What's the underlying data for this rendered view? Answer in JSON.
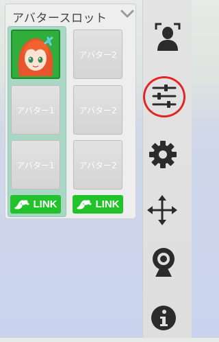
{
  "panel": {
    "title": "アバタースロット",
    "chevron_icon": "chevron-down-icon"
  },
  "slots": {
    "left": [
      {
        "label": "",
        "selected": true,
        "content": "avatar-thumbnail"
      },
      {
        "label": "アバター1"
      },
      {
        "label": "アバター1"
      }
    ],
    "right": [
      {
        "label": "アバター2"
      },
      {
        "label": "アバター2"
      },
      {
        "label": "アバター2"
      }
    ]
  },
  "link_buttons": [
    {
      "label": "LINK",
      "icon": "link-icon"
    },
    {
      "label": "LINK",
      "icon": "link-icon"
    }
  ],
  "toolbar": {
    "items": [
      {
        "icon": "face-tracking-icon"
      },
      {
        "icon": "sliders-icon",
        "active": true
      },
      {
        "icon": "gear-icon"
      },
      {
        "icon": "move-icon"
      },
      {
        "icon": "webcam-icon"
      },
      {
        "icon": "info-icon"
      }
    ]
  },
  "colors": {
    "selected_column": "#a9d7c6",
    "selected_slot": "#27a635",
    "link_button": "#22c22a",
    "active_highlight": "#e62323",
    "icon": "#2b2b2b"
  }
}
